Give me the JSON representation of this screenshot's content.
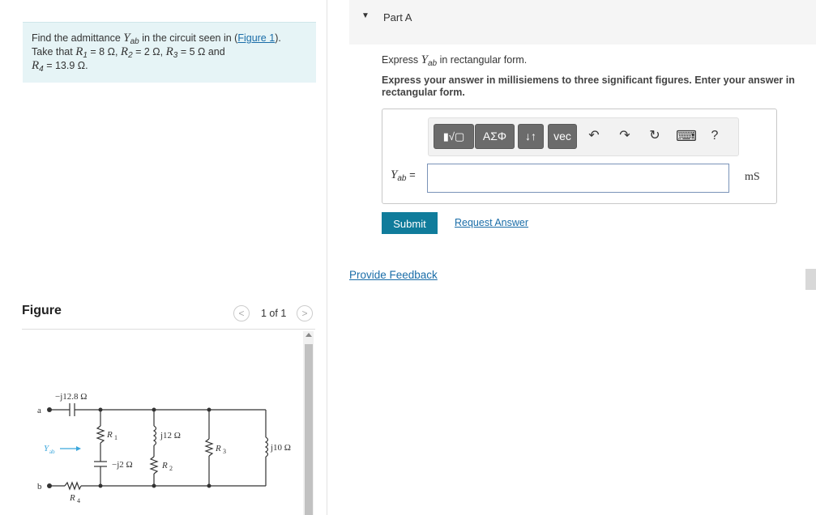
{
  "problem": {
    "text_a": "Find the admittance ",
    "sym_Y": "Y",
    "sym_ab": "ab",
    "text_b": " in the circuit seen in (",
    "fig_link": "Figure 1",
    "text_c": ").",
    "line2_a": "Take that ",
    "r1": "R",
    "r1_sub": "1",
    "r1_val": " = 8 Ω, ",
    "r2": "R",
    "r2_sub": "2",
    "r2_val": " = 2 Ω, ",
    "r3": "R",
    "r3_sub": "3",
    "r3_val": " = 5 Ω and",
    "r4": "R",
    "r4_sub": "4",
    "r4_val": " = 13.9 Ω."
  },
  "figure": {
    "title": "Figure",
    "pager": "1 of 1",
    "prev": "<",
    "next": ">",
    "circuit": {
      "node_a": "a",
      "node_b": "b",
      "yab": "Y",
      "yab_sub": "ab",
      "cap1": "−j12.8 Ω",
      "r1": "R",
      "r1_sub": "1",
      "cap2": "−j2 Ω",
      "ind1": "j12 Ω",
      "r2": "R",
      "r2_sub": "2",
      "r3": "R",
      "r3_sub": "3",
      "ind2": "j10 Ω",
      "r4": "R",
      "r4_sub": "4"
    }
  },
  "partA": {
    "title": "Part A",
    "instr1_a": "Express ",
    "instr1_Y": "Y",
    "instr1_ab": "ab",
    "instr1_b": " in rectangular form.",
    "instr2": "Express your answer in millisiemens to three significant figures. Enter your answer in rectangular form.",
    "toolbar": {
      "template": "▮√▢",
      "greek": "ΑΣΦ",
      "arrows": "↓↑",
      "vec": "vec",
      "undo": "↶",
      "redo": "↷",
      "reset": "↻",
      "keyboard": "⌨",
      "help": "?"
    },
    "input_label_Y": "Y",
    "input_label_ab": "ab",
    "input_label_eq": " =",
    "input_value": "",
    "unit": "mS",
    "submit": "Submit",
    "request": "Request Answer"
  },
  "feedback": "Provide Feedback"
}
